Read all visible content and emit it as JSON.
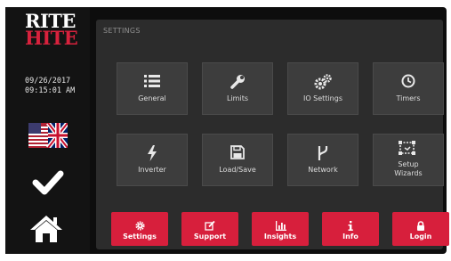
{
  "logo": {
    "line1": "RITE",
    "line2": "HITE"
  },
  "status": {
    "date": "09/26/2017",
    "time": "09:15:01 AM"
  },
  "sidebar": {
    "language_icon": "uk-us-flag-icon",
    "confirm_icon": "check-icon",
    "home_icon": "home-icon"
  },
  "panel": {
    "title": "SETTINGS"
  },
  "tiles": [
    {
      "label": "General",
      "icon": "list-icon"
    },
    {
      "label": "Limits",
      "icon": "wrench-icon"
    },
    {
      "label": "IO Settings",
      "icon": "gears-icon"
    },
    {
      "label": "Timers",
      "icon": "clock-icon"
    },
    {
      "label": "Inverter",
      "icon": "lightning-icon"
    },
    {
      "label": "Load/Save",
      "icon": "floppy-icon"
    },
    {
      "label": "Network",
      "icon": "network-icon"
    },
    {
      "label": "Setup Wizards",
      "icon": "wizard-icon"
    }
  ],
  "bottom_buttons": [
    {
      "label": "Settings",
      "icon": "gear-icon"
    },
    {
      "label": "Support",
      "icon": "edit-icon"
    },
    {
      "label": "Insights",
      "icon": "chart-icon"
    },
    {
      "label": "Info",
      "icon": "info-icon"
    },
    {
      "label": "Login",
      "icon": "lock-icon"
    }
  ],
  "colors": {
    "accent": "#d71f3c",
    "panel": "#2c2c2c",
    "tile": "#3d3d3d",
    "background": "#0d0d0d"
  }
}
